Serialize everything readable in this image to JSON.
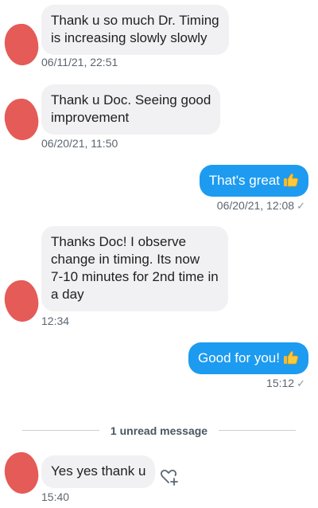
{
  "messages": [
    {
      "lines": [
        "Thank u so much Dr. Timing",
        "is increasing slowly slowly"
      ],
      "time": "06/11/21, 22:51"
    },
    {
      "lines": [
        "Thank u Doc. Seeing good",
        "improvement"
      ],
      "time": "06/20/21, 11:50"
    },
    {
      "text": "That's great",
      "time": "06/20/21, 12:08",
      "status": "✓"
    },
    {
      "lines": [
        "Thanks Doc! I observe",
        "change in timing. Its now",
        "7-10 minutes for 2nd time in",
        "a day"
      ],
      "time": "12:34"
    },
    {
      "text": "Good for you!",
      "time": "15:12",
      "status": "✓"
    },
    {
      "text": "Yes yes thank u",
      "time": "15:40"
    }
  ],
  "divider": {
    "label": "1 unread message"
  },
  "icons": {
    "thumbs_up": "thumbs-up-emoji",
    "react": "heart-plus-icon"
  },
  "colors": {
    "outgoing_bubble": "#1d9bf0",
    "incoming_bubble": "#f1f1f3",
    "avatar": "#e55b57"
  }
}
